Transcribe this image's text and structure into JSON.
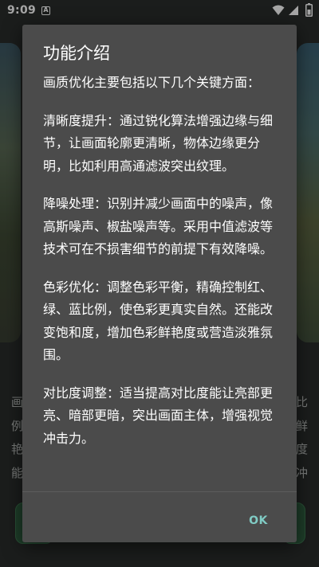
{
  "status_bar": {
    "time": "9:09",
    "notification_icon_letter": "A",
    "icons": [
      "wifi-icon",
      "signal-icon",
      "battery-icon"
    ]
  },
  "background": {
    "left_text_lines": [
      "画",
      "例",
      "艳",
      "能"
    ],
    "right_text_lines": [
      "比",
      "鲜",
      "度",
      "冲"
    ]
  },
  "dialog": {
    "title": "功能介绍",
    "paragraphs": [
      "画质优化主要包括以下几个关键方面：",
      "清晰度提升：通过锐化算法增强边缘与细节，让画面轮廓更清晰，物体边缘更分明，比如利用高通滤波突出纹理。",
      "降噪处理：识别并减少画面中的噪声，像高斯噪声、椒盐噪声等。采用中值滤波等技术可在不损害细节的前提下有效降噪。",
      "色彩优化：调整色彩平衡，精确控制红、绿、蓝比例，使色彩更真实自然。还能改变饱和度，增加色彩鲜艳度或营造淡雅氛围。",
      "对比度调整：适当提高对比度能让亮部更亮、暗部更暗，突出画面主体，增强视觉冲击力。"
    ],
    "ok_label": "OK"
  },
  "colors": {
    "dialog_background": "#4b4b4b",
    "accent": "#80cbc4",
    "text": "#ffffff"
  }
}
